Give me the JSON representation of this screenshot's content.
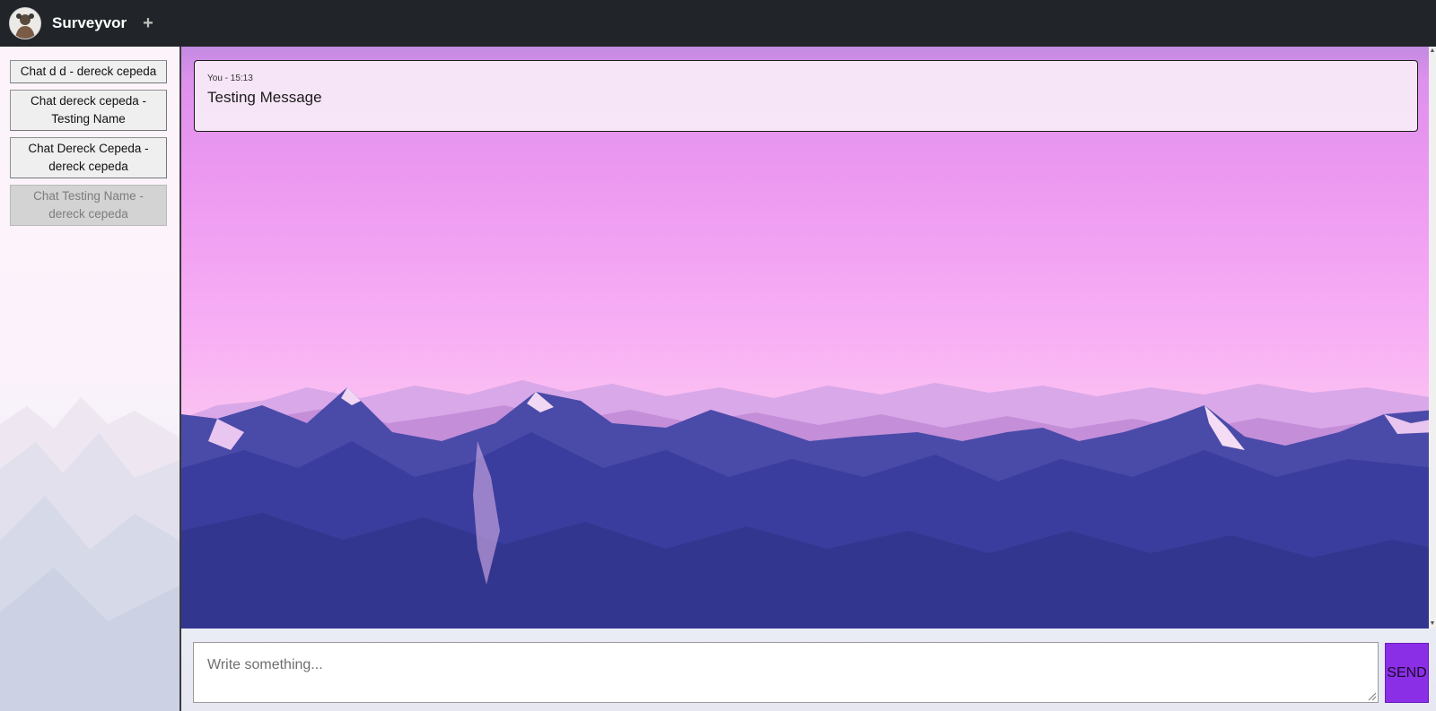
{
  "app": {
    "brand": "Surveyvor",
    "add_icon": "plus-icon",
    "avatar_icon": "user-avatar-icon"
  },
  "sidebar": {
    "items": [
      {
        "label": "Chat d d - dereck cepeda",
        "disabled": false
      },
      {
        "label": "Chat dereck cepeda - Testing Name",
        "disabled": false
      },
      {
        "label": "Chat Dereck Cepeda - dereck cepeda",
        "disabled": false
      },
      {
        "label": "Chat Testing Name - dereck cepeda",
        "disabled": true
      }
    ]
  },
  "messages": [
    {
      "meta": "You - 15:13",
      "text": "Testing Message"
    }
  ],
  "composer": {
    "placeholder": "Write something...",
    "send_label": "SEND"
  },
  "colors": {
    "navbar": "#212529",
    "send_button": "#8b2fe6",
    "sky_top": "#c48ae2",
    "sky_bottom": "#fbc3f2",
    "mountains": "#3b3d9e"
  }
}
